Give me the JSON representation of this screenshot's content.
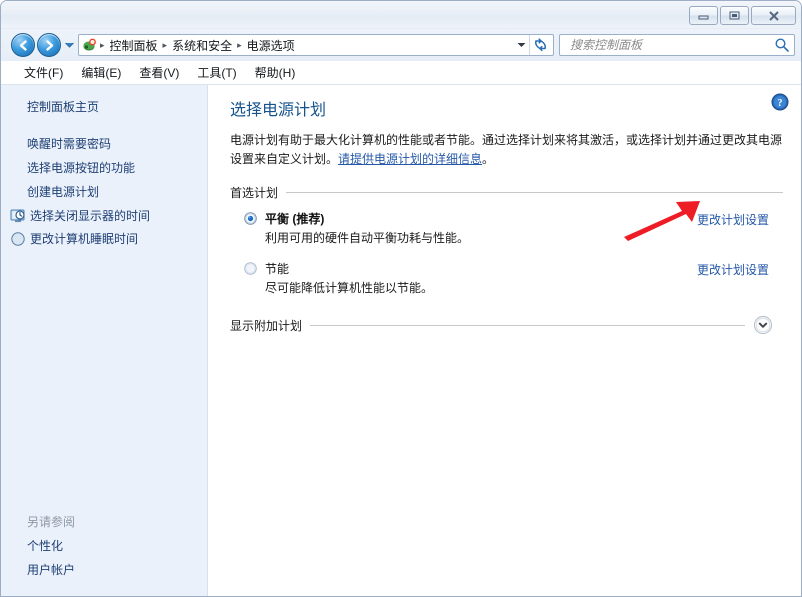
{
  "window": {
    "buttons": {
      "minimize": "minimize-button",
      "maximize": "maximize-button",
      "close": "close-button"
    }
  },
  "nav": {
    "back_label": "后退",
    "forward_label": "前进",
    "recent_label": "最近浏览的位置",
    "breadcrumbs": [
      "控制面板",
      "系统和安全",
      "电源选项"
    ],
    "separator": "▸",
    "refresh_label": "刷新"
  },
  "search": {
    "placeholder": "搜索控制面板",
    "value": ""
  },
  "menu": {
    "items": [
      "文件(F)",
      "编辑(E)",
      "查看(V)",
      "工具(T)",
      "帮助(H)"
    ]
  },
  "sidebar": {
    "home": "控制面板主页",
    "links": [
      "唤醒时需要密码",
      "选择电源按钮的功能",
      "创建电源计划"
    ],
    "icon_links": [
      {
        "label": "选择关闭显示器的时间",
        "icon": "monitor-clock-icon"
      },
      {
        "label": "更改计算机睡眠时间",
        "icon": "moon-sleep-icon"
      }
    ],
    "see_also_title": "另请参阅",
    "see_also_links": [
      "个性化",
      "用户帐户"
    ]
  },
  "main": {
    "help_label": "帮助",
    "title": "选择电源计划",
    "intro_part1": "电源计划有助于最大化计算机的性能或者节能。通过选择计划来将其激活，或选择计划并通过更改其电源设置来自定义计划。",
    "intro_link": "请提供电源计划的详细信息",
    "intro_part2": "。",
    "preferred_section": "首选计划",
    "plans": [
      {
        "name": "平衡 (推荐)",
        "description": "利用可用的硬件自动平衡功耗与性能。",
        "selected": true,
        "link": "更改计划设置"
      },
      {
        "name": "节能",
        "description": "尽可能降低计算机性能以节能。",
        "selected": false,
        "link": "更改计划设置"
      }
    ],
    "show_additional": "显示附加计划",
    "expand_label": "展开"
  },
  "colors": {
    "accent_link": "#2558a8",
    "title_blue": "#16538c",
    "sidebar_bg": "#eaf1fb",
    "annotation_red": "#ee1c25",
    "radio_blue": "#1b6fc4"
  }
}
